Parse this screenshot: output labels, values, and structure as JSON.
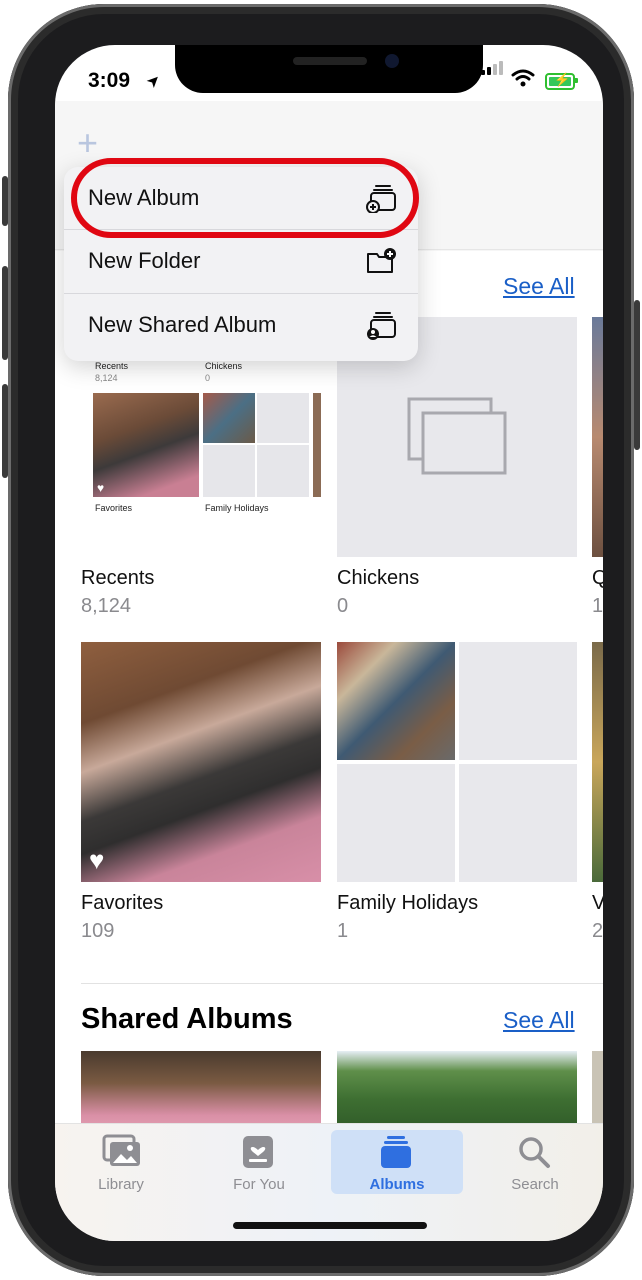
{
  "status_bar": {
    "time": "3:09",
    "location_arrow": "➤"
  },
  "menu": {
    "items": [
      {
        "label": "New Album",
        "icon": "stacked-album-plus-icon"
      },
      {
        "label": "New Folder",
        "icon": "folder-plus-icon"
      },
      {
        "label": "New Shared Album",
        "icon": "stacked-album-person-icon"
      }
    ],
    "highlight_color": "#e00712"
  },
  "my_albums": {
    "see_all": "See All",
    "albums": [
      {
        "title": "Recents",
        "count": "8,124"
      },
      {
        "title": "Chickens",
        "count": "0"
      },
      {
        "title": "Q",
        "count": "1"
      },
      {
        "title": "Favorites",
        "count": "109"
      },
      {
        "title": "Family Holidays",
        "count": "1"
      },
      {
        "title": "V",
        "count": "2"
      }
    ],
    "recents_thumb": {
      "label_recents": "Recents",
      "count_recents": "8,124",
      "label_chickens": "Chickens",
      "count_chickens": "0",
      "label_favorites": "Favorites",
      "label_family": "Family Holidays"
    }
  },
  "shared_albums": {
    "title": "Shared Albums",
    "see_all": "See All"
  },
  "tab_bar": {
    "tabs": [
      {
        "label": "Library",
        "icon": "photo-library-icon"
      },
      {
        "label": "For You",
        "icon": "for-you-icon"
      },
      {
        "label": "Albums",
        "icon": "albums-stack-icon",
        "active": true
      },
      {
        "label": "Search",
        "icon": "search-icon"
      }
    ],
    "active_color": "#2f6fe0"
  }
}
